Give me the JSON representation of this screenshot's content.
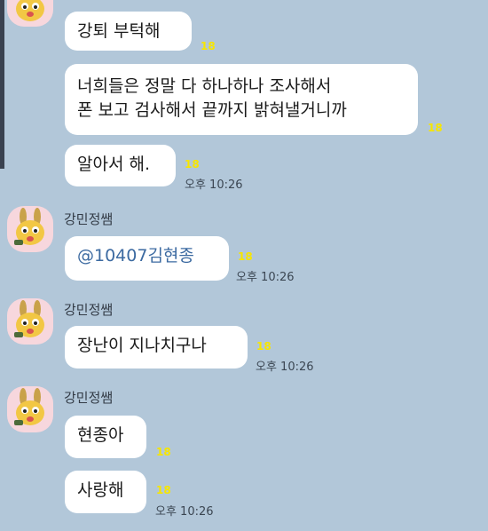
{
  "chat": {
    "messages": [
      {
        "text": "강퇴 부턱해",
        "unread": "18"
      },
      {
        "text_line1": "너희들은 정말 다 하나하나 조사해서",
        "text_line2": "폰 보고 검사해서 끝까지 밝혀낼거니까",
        "unread": "18"
      },
      {
        "text": "알아서 해.",
        "unread": "18",
        "time": "오후 10:26"
      },
      {
        "sender": "강민정쌤",
        "text": "@10407김현종",
        "unread": "18",
        "time": "오후 10:26"
      },
      {
        "sender": "강민정쌤",
        "text": "장난이 지나치구나",
        "unread": "18",
        "time": "오후 10:26"
      },
      {
        "sender": "강민정쌤",
        "text": "현종아",
        "unread": "18"
      },
      {
        "text": "사랑해",
        "unread": "18",
        "time": "오후 10:26"
      }
    ]
  },
  "colors": {
    "background": "#b2c7d9",
    "bubble": "#ffffff",
    "unread": "#f7e600",
    "mention": "#3c6aa1",
    "avatar_bg": "#f7d7dd"
  },
  "icons": {
    "avatar": "cartoon-bunny-avatar-icon"
  }
}
